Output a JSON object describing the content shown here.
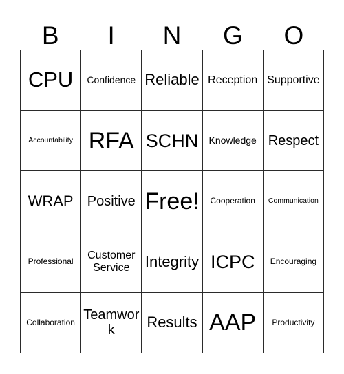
{
  "card": {
    "title": "BINGO",
    "free_space_label": "Free!",
    "columns": 5,
    "rows": 5,
    "grid_line_color": "#2b2b2b",
    "background_color": "#ffffff",
    "text_color": "#000000"
  },
  "header": {
    "letters": [
      "B",
      "I",
      "N",
      "G",
      "O"
    ]
  },
  "grid": {
    "rows": [
      {
        "cells": [
          {
            "label": "CPU",
            "size": "fs-xl"
          },
          {
            "label": "Confidence",
            "size": "fs-xs"
          },
          {
            "label": "Reliable",
            "size": "fs-ml"
          },
          {
            "label": "Reception",
            "size": "fs-sm"
          },
          {
            "label": "Supportive",
            "size": "fs-sm"
          }
        ]
      },
      {
        "cells": [
          {
            "label": "Accountability",
            "size": "fs-tiny"
          },
          {
            "label": "RFA",
            "size": "fs-xxl"
          },
          {
            "label": "SCHN",
            "size": "fs-lg"
          },
          {
            "label": "Knowledge",
            "size": "fs-xs"
          },
          {
            "label": "Respect",
            "size": "fs-md"
          }
        ]
      },
      {
        "cells": [
          {
            "label": "WRAP",
            "size": "fs-ml"
          },
          {
            "label": "Positive",
            "size": "fs-md"
          },
          {
            "label": "Free!",
            "size": "fs-xxl"
          },
          {
            "label": "Cooperation",
            "size": "fs-xxs"
          },
          {
            "label": "Communication",
            "size": "fs-tiny"
          }
        ]
      },
      {
        "cells": [
          {
            "label": "Professional",
            "size": "fs-xxs"
          },
          {
            "label": "Customer Service",
            "size": "fs-sm"
          },
          {
            "label": "Integrity",
            "size": "fs-ml"
          },
          {
            "label": "ICPC",
            "size": "fs-lg"
          },
          {
            "label": "Encouraging",
            "size": "fs-xxs"
          }
        ]
      },
      {
        "cells": [
          {
            "label": "Collaboration",
            "size": "fs-xxs"
          },
          {
            "label": "Teamwork",
            "size": "fs-md"
          },
          {
            "label": "Results",
            "size": "fs-ml"
          },
          {
            "label": "AAP",
            "size": "fs-xxl"
          },
          {
            "label": "Productivity",
            "size": "fs-xxs"
          }
        ]
      }
    ]
  }
}
